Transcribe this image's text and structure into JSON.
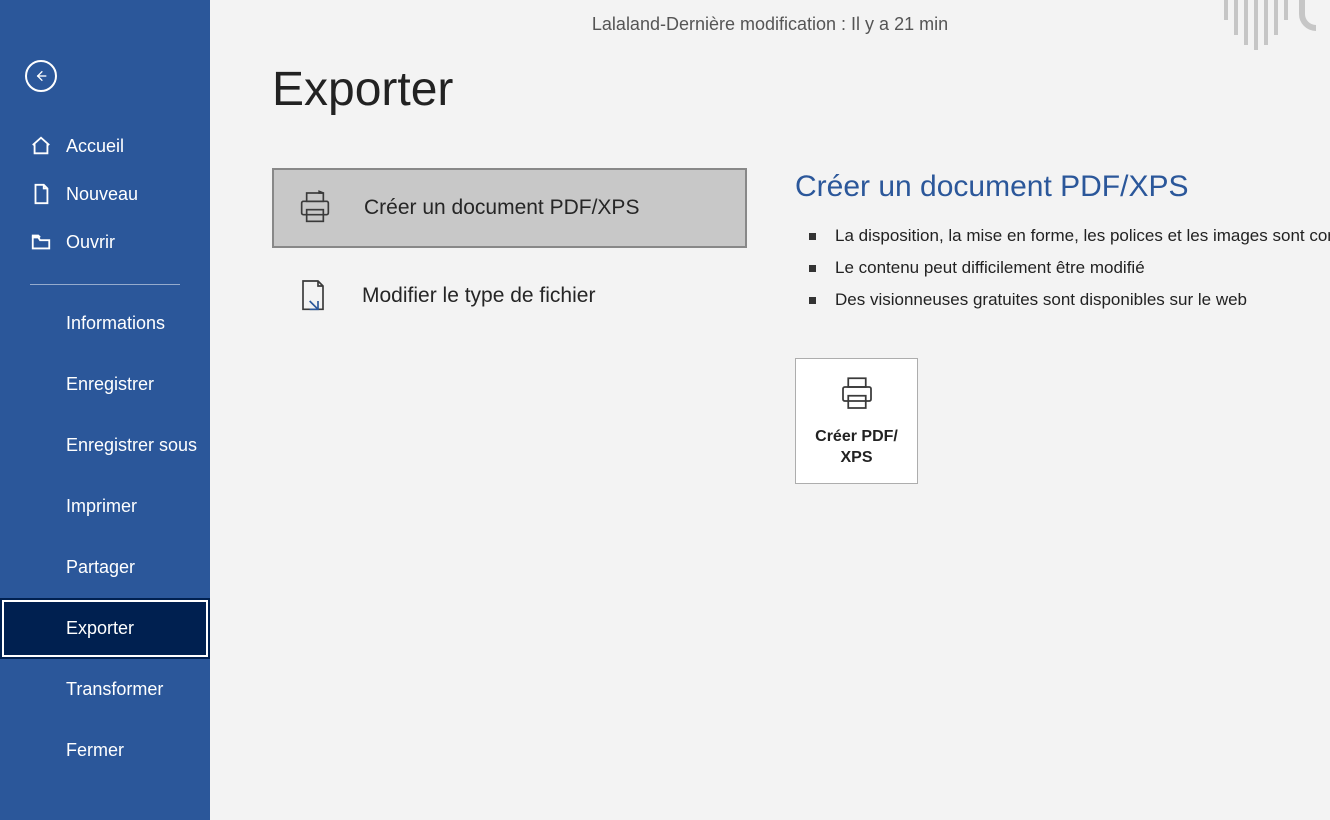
{
  "header": {
    "doc_name": "Lalaland",
    "separator": "  -  ",
    "last_modified": "Dernière modification : Il y a 21 min"
  },
  "page_title": "Exporter",
  "sidebar": {
    "primary": [
      {
        "key": "home",
        "label": "Accueil"
      },
      {
        "key": "new",
        "label": "Nouveau"
      },
      {
        "key": "open",
        "label": "Ouvrir"
      }
    ],
    "secondary": [
      {
        "key": "info",
        "label": "Informations"
      },
      {
        "key": "save",
        "label": "Enregistrer"
      },
      {
        "key": "saveas",
        "label": "Enregistrer sous"
      },
      {
        "key": "print",
        "label": "Imprimer"
      },
      {
        "key": "share",
        "label": "Partager"
      },
      {
        "key": "export",
        "label": "Exporter",
        "active": true
      },
      {
        "key": "transform",
        "label": "Transformer"
      },
      {
        "key": "close",
        "label": "Fermer"
      }
    ]
  },
  "export_options": [
    {
      "key": "pdfxps",
      "label": "Créer un document PDF/XPS",
      "selected": true
    },
    {
      "key": "filetype",
      "label": "Modifier le type de fichier"
    }
  ],
  "details": {
    "title": "Créer un document PDF/XPS",
    "bullets": [
      "La disposition, la mise en forme, les polices et les images sont conservées",
      "Le contenu peut difficilement être modifié",
      "Des visionneuses gratuites sont disponibles sur le web"
    ],
    "create_button_label": "Créer PDF/XPS"
  }
}
